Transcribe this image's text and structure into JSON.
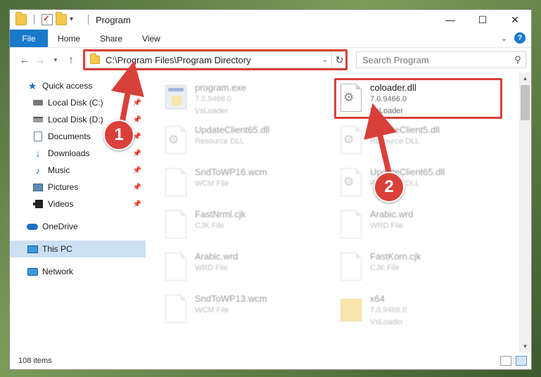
{
  "window": {
    "title": "Program"
  },
  "ribbon": {
    "tabs": [
      "File",
      "Home",
      "Share",
      "View"
    ]
  },
  "address": {
    "path": "C:\\Program Files\\Program Directory"
  },
  "search": {
    "placeholder": "Search Program"
  },
  "sidebar": {
    "items": [
      {
        "label": "Quick access",
        "icon": "star-icon"
      },
      {
        "label": "Local Disk (C:)",
        "icon": "disk-icon",
        "pinned": true
      },
      {
        "label": "Local Disk (D:)",
        "icon": "disk-icon",
        "pinned": true
      },
      {
        "label": "Documents",
        "icon": "documents-icon",
        "pinned": true
      },
      {
        "label": "Downloads",
        "icon": "download-icon",
        "pinned": true
      },
      {
        "label": "Music",
        "icon": "music-icon",
        "pinned": true
      },
      {
        "label": "Pictures",
        "icon": "pictures-icon",
        "pinned": true
      },
      {
        "label": "Videos",
        "icon": "videos-icon",
        "pinned": true
      },
      {
        "label": "OneDrive",
        "icon": "cloud-icon"
      },
      {
        "label": "This PC",
        "icon": "computer-icon",
        "selected": true
      },
      {
        "label": "Network",
        "icon": "network-icon"
      }
    ]
  },
  "files": [
    {
      "name": "program.exe",
      "line2": "7.0.9466.0",
      "line3": "VsLoader",
      "icon": "exe-icon",
      "blurred": true
    },
    {
      "name": "coloader.dll",
      "line2": "7.0.9466.0",
      "line3": "VsLoader",
      "icon": "dll-icon",
      "highlighted": true
    },
    {
      "name": "UpdateClient65.dll",
      "line2": "Resource DLL",
      "line3": "",
      "icon": "dll-icon",
      "blurred": true
    },
    {
      "name": "UpdateClient5.dll",
      "line2": "Resource DLL",
      "line3": "",
      "icon": "dll-icon",
      "blurred": true
    },
    {
      "name": "SndToWP16.wcm",
      "line2": "WCM File",
      "line3": "",
      "icon": "file-icon",
      "blurred": true
    },
    {
      "name": "UpdateClient65.dll",
      "line2": "Resource DLL",
      "line3": "",
      "icon": "dll-icon",
      "blurred": true
    },
    {
      "name": "FastNrml.cjk",
      "line2": "CJK File",
      "line3": "",
      "icon": "file-icon",
      "blurred": true
    },
    {
      "name": "Arabic.wrd",
      "line2": "WRD File",
      "line3": "",
      "icon": "file-icon",
      "blurred": true
    },
    {
      "name": "Arabic.wrd",
      "line2": "WRD File",
      "line3": "",
      "icon": "file-icon",
      "blurred": true
    },
    {
      "name": "FastKorn.cjk",
      "line2": "CJK File",
      "line3": "",
      "icon": "file-icon",
      "blurred": true
    },
    {
      "name": "SndToWP13.wcm",
      "line2": "WCM File",
      "line3": "",
      "icon": "file-icon",
      "blurred": true
    },
    {
      "name": "x64",
      "line2": "7.0.9466.0",
      "line3": "VsLoader",
      "icon": "folder-icon",
      "blurred": true
    }
  ],
  "status": {
    "count": "108 items"
  },
  "annotations": {
    "badge1": "1",
    "badge2": "2",
    "color": "#d9403a"
  }
}
